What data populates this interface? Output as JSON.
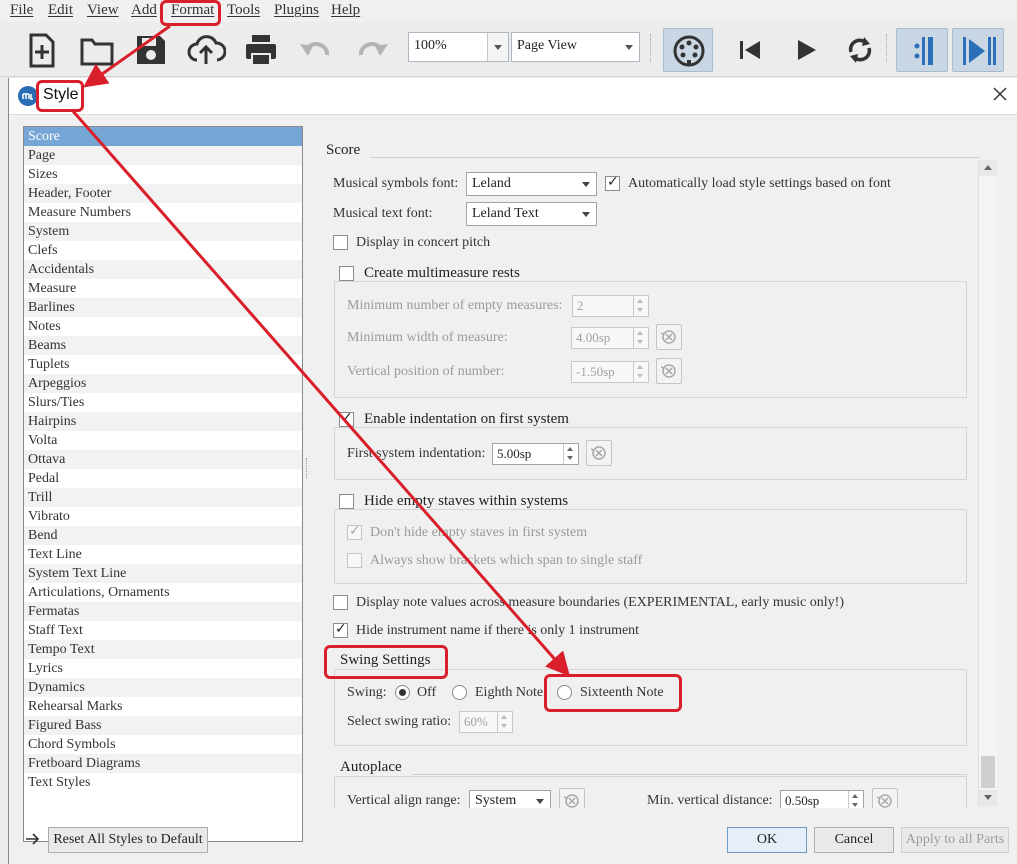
{
  "menubar": {
    "items": [
      "File",
      "Edit",
      "View",
      "Add",
      "Format",
      "Tools",
      "Plugins",
      "Help"
    ]
  },
  "toolbar": {
    "zoom": "100%",
    "view_mode": "Page View",
    "icons": [
      "new-score-icon",
      "open-folder-icon",
      "save-icon",
      "cloud-upload-icon",
      "print-icon",
      "undo-icon",
      "redo-icon",
      "midi-input-icon",
      "rewind-icon",
      "play-icon",
      "loop-icon",
      "repeat-playback-icon",
      "pan-score-icon"
    ]
  },
  "dialog": {
    "title": "Style",
    "categories": [
      "Score",
      "Page",
      "Sizes",
      "Header, Footer",
      "Measure Numbers",
      "System",
      "Clefs",
      "Accidentals",
      "Measure",
      "Barlines",
      "Notes",
      "Beams",
      "Tuplets",
      "Arpeggios",
      "Slurs/Ties",
      "Hairpins",
      "Volta",
      "Ottava",
      "Pedal",
      "Trill",
      "Vibrato",
      "Bend",
      "Text Line",
      "System Text Line",
      "Articulations, Ornaments",
      "Fermatas",
      "Staff Text",
      "Tempo Text",
      "Lyrics",
      "Dynamics",
      "Rehearsal Marks",
      "Figured Bass",
      "Chord Symbols",
      "Fretboard Diagrams",
      "Text Styles"
    ],
    "selected_category": "Score",
    "score": {
      "section_title": "Score",
      "musical_symbols_font_label": "Musical symbols font:",
      "musical_symbols_font": "Leland",
      "auto_load_label": "Automatically load style settings based on font",
      "musical_text_font_label": "Musical text font:",
      "musical_text_font": "Leland Text",
      "concert_pitch_label": "Display in concert pitch",
      "multimeasure_title": "Create multimeasure rests",
      "min_empty_label": "Minimum number of empty measures:",
      "min_empty_value": "2",
      "min_width_label": "Minimum width of measure:",
      "min_width_value": "4.00sp",
      "vert_pos_label": "Vertical position of number:",
      "vert_pos_value": "-1.50sp",
      "indent_title": "Enable indentation on first system",
      "indent_label": "First system indentation:",
      "indent_value": "5.00sp",
      "hide_empty_title": "Hide empty staves within systems",
      "dont_hide_first_label": "Don't hide empty staves in first system",
      "always_brackets_label": "Always show brackets which span to single staff",
      "note_values_label": "Display note values across measure boundaries (EXPERIMENTAL, early music only!)",
      "hide_instrument_label": "Hide instrument name if there is only 1 instrument"
    },
    "swing": {
      "title": "Swing Settings",
      "swing_label": "Swing:",
      "options": [
        "Off",
        "Eighth Note",
        "Sixteenth Note"
      ],
      "selected": "Off",
      "ratio_label": "Select swing ratio:",
      "ratio_value": "60%"
    },
    "autoplace": {
      "title": "Autoplace",
      "vertical_align_label": "Vertical align range:",
      "vertical_align_value": "System",
      "min_vertical_label": "Min. vertical distance:",
      "min_vertical_value": "0.50sp"
    },
    "buttons": {
      "reset_all": "Reset All Styles to Default",
      "ok": "OK",
      "cancel": "Cancel",
      "apply_all": "Apply to all Parts"
    }
  },
  "annotation_color": "#d91f2a",
  "highlight_color": "#76a6d6"
}
